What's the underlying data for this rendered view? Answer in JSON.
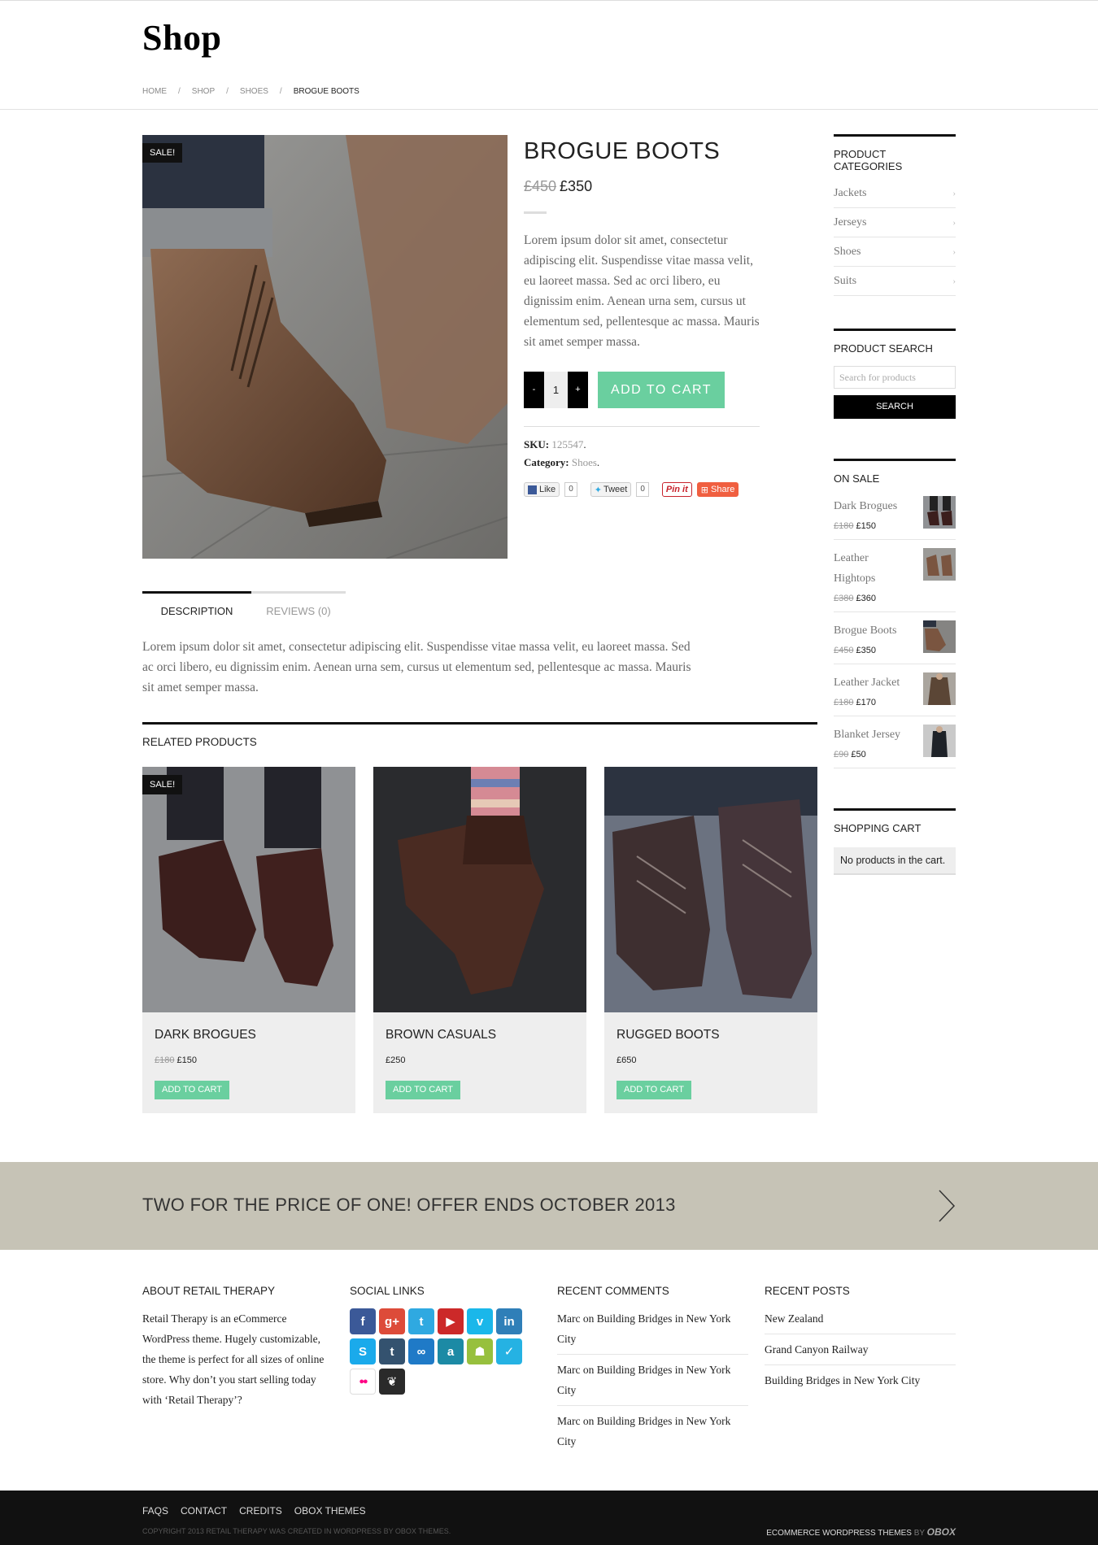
{
  "header": {
    "site_title": "Shop",
    "breadcrumb": [
      "HOME",
      "SHOP",
      "SHOES",
      "BROGUE BOOTS"
    ],
    "breadcrumb_sep": "/"
  },
  "product": {
    "sale_badge": "SALE!",
    "title": "BROGUE BOOTS",
    "old_price": "£450",
    "price": "£350",
    "short_description": "Lorem ipsum dolor sit amet, consectetur adipiscing elit. Suspendisse vitae massa velit, eu laoreet massa. Sed ac orci libero, eu dignissim enim. Aenean urna sem, cursus ut elementum sed, pellentesque ac massa. Mauris sit amet semper massa.",
    "qty_minus": "-",
    "qty_value": "1",
    "qty_plus": "+",
    "add_to_cart": "ADD TO CART",
    "sku_label": "SKU:",
    "sku_value": "125547",
    "category_label": "Category:",
    "category_value": "Shoes",
    "social": {
      "like": "Like",
      "like_count": "0",
      "tweet": "Tweet",
      "tweet_count": "0",
      "pin": "Pin it",
      "share": "Share"
    }
  },
  "tabs": {
    "description": "DESCRIPTION",
    "reviews": "REVIEWS (0)",
    "content": "Lorem ipsum dolor sit amet, consectetur adipiscing elit. Suspendisse vitae massa velit, eu laoreet massa. Sed ac orci libero, eu dignissim enim. Aenean urna sem, cursus ut elementum sed, pellentesque ac massa. Mauris sit amet semper massa."
  },
  "related": {
    "title": "RELATED PRODUCTS",
    "items": [
      {
        "sale": "SALE!",
        "name": "DARK BROGUES",
        "old_price": "£180",
        "price": "£150",
        "button": "ADD TO CART"
      },
      {
        "name": "BROWN CASUALS",
        "price": "£250",
        "button": "ADD TO CART"
      },
      {
        "name": "RUGGED BOOTS",
        "price": "£650",
        "button": "ADD TO CART"
      }
    ]
  },
  "sidebar": {
    "categories_title": "PRODUCT CATEGORIES",
    "categories": [
      "Jackets",
      "Jerseys",
      "Shoes",
      "Suits"
    ],
    "chevron": "›",
    "search_title": "PRODUCT SEARCH",
    "search_placeholder": "Search for products",
    "search_button": "SEARCH",
    "on_sale_title": "ON SALE",
    "on_sale": [
      {
        "name": "Dark Brogues",
        "old_price": "£180",
        "price": "£150"
      },
      {
        "name": "Leather Hightops",
        "old_price": "£380",
        "price": "£360"
      },
      {
        "name": "Brogue Boots",
        "old_price": "£450",
        "price": "£350"
      },
      {
        "name": "Leather Jacket",
        "old_price": "£180",
        "price": "£170"
      },
      {
        "name": "Blanket Jersey",
        "old_price": "£90",
        "price": "£50"
      }
    ],
    "cart_title": "SHOPPING CART",
    "cart_empty": "No products in the cart."
  },
  "promo": {
    "text": "TWO FOR THE PRICE OF ONE! OFFER ENDS OCTOBER 2013"
  },
  "footer": {
    "about_title": "ABOUT RETAIL THERAPY",
    "about_text": "Retail Therapy is an eCommerce WordPress theme. Hugely customizable, the theme is perfect for all sizes of online store. Why don’t you start selling today with ‘Retail Therapy’?",
    "social_title": "SOCIAL LINKS",
    "social_icons": [
      {
        "name": "facebook-icon",
        "glyph": "f",
        "color": "#3b5998"
      },
      {
        "name": "google-plus-icon",
        "glyph": "g+",
        "color": "#dd4b39"
      },
      {
        "name": "twitter-icon",
        "glyph": "t",
        "color": "#2fa9e1"
      },
      {
        "name": "youtube-icon",
        "glyph": "▶",
        "color": "#cc2929"
      },
      {
        "name": "vimeo-icon",
        "glyph": "v",
        "color": "#1ab7ea"
      },
      {
        "name": "linkedin-icon",
        "glyph": "in",
        "color": "#2f7fb8"
      },
      {
        "name": "skype-icon",
        "glyph": "S",
        "color": "#1aaaeb"
      },
      {
        "name": "tumblr-icon",
        "glyph": "t",
        "color": "#34526f"
      },
      {
        "name": "delicious-icon",
        "glyph": "∞",
        "color": "#1f7ac7"
      },
      {
        "name": "amazon-icon",
        "glyph": "a",
        "color": "#1c8aa5"
      },
      {
        "name": "android-icon",
        "glyph": "☗",
        "color": "#97c03d"
      },
      {
        "name": "foursquare-icon",
        "glyph": "✓",
        "color": "#25b2e3"
      },
      {
        "name": "flickr-icon",
        "glyph": "●●",
        "color": "#ffffff"
      },
      {
        "name": "evernote-icon",
        "glyph": "❦",
        "color": "#2a2a2a"
      }
    ],
    "comments_title": "RECENT COMMENTS",
    "comments": [
      {
        "author": "Marc",
        "on": "on",
        "post": "Building Bridges in New York City"
      },
      {
        "author": "Marc",
        "on": "on",
        "post": "Building Bridges in New York City"
      },
      {
        "author": "Marc",
        "on": "on",
        "post": "Building Bridges in New York City"
      }
    ],
    "posts_title": "RECENT POSTS",
    "posts": [
      "New Zealand",
      "Grand Canyon Railway",
      "Building Bridges in New York City"
    ]
  },
  "bottom_bar": {
    "nav": [
      "FAQS",
      "CONTACT",
      "CREDITS",
      "OBOX THEMES"
    ],
    "copyright": "COPYRIGHT 2013 RETAIL THERAPY WAS CREATED IN WORDPRESS BY OBOX THEMES.",
    "credit": "ECOMMERCE WORDPRESS THEMES",
    "credit_by": "BY",
    "credit_brand": "Obox"
  }
}
